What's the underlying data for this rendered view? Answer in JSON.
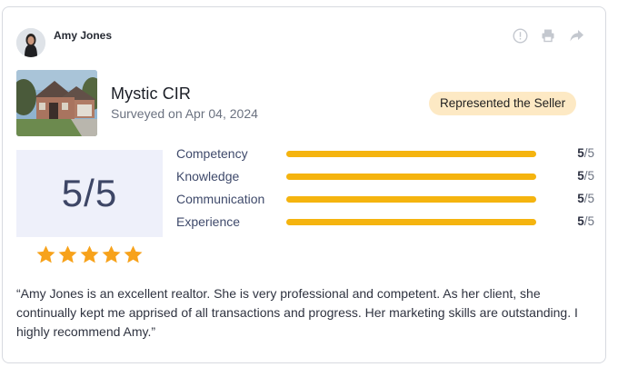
{
  "reviewer": {
    "name": "Amy Jones"
  },
  "actions": [
    {
      "icon": "info-icon"
    },
    {
      "icon": "print-icon"
    },
    {
      "icon": "share-icon"
    }
  ],
  "property": {
    "title": "Mystic CIR",
    "surveyed": "Surveyed on Apr 04, 2024",
    "badge": "Represented the Seller"
  },
  "overall": {
    "score": "5/5",
    "stars": 5,
    "max_stars": 5
  },
  "ratings": [
    {
      "label": "Competency",
      "score": "5",
      "max": "/5",
      "fraction": 1.0
    },
    {
      "label": "Knowledge",
      "score": "5",
      "max": "/5",
      "fraction": 1.0
    },
    {
      "label": "Communication",
      "score": "5",
      "max": "/5",
      "fraction": 1.0
    },
    {
      "label": "Experience",
      "score": "5",
      "max": "/5",
      "fraction": 1.0
    }
  ],
  "review_text": "“Amy Jones is an excellent realtor. She is very professional and competent. As her client, she continually kept me apprised of all transactions and progress. Her marketing skills are outstanding. I highly recommend Amy.”",
  "colors": {
    "accent_bar": "#f5b40f",
    "star": "#f7a21b",
    "badge_bg": "#fde9c4",
    "score_bg": "#eef0fa"
  }
}
